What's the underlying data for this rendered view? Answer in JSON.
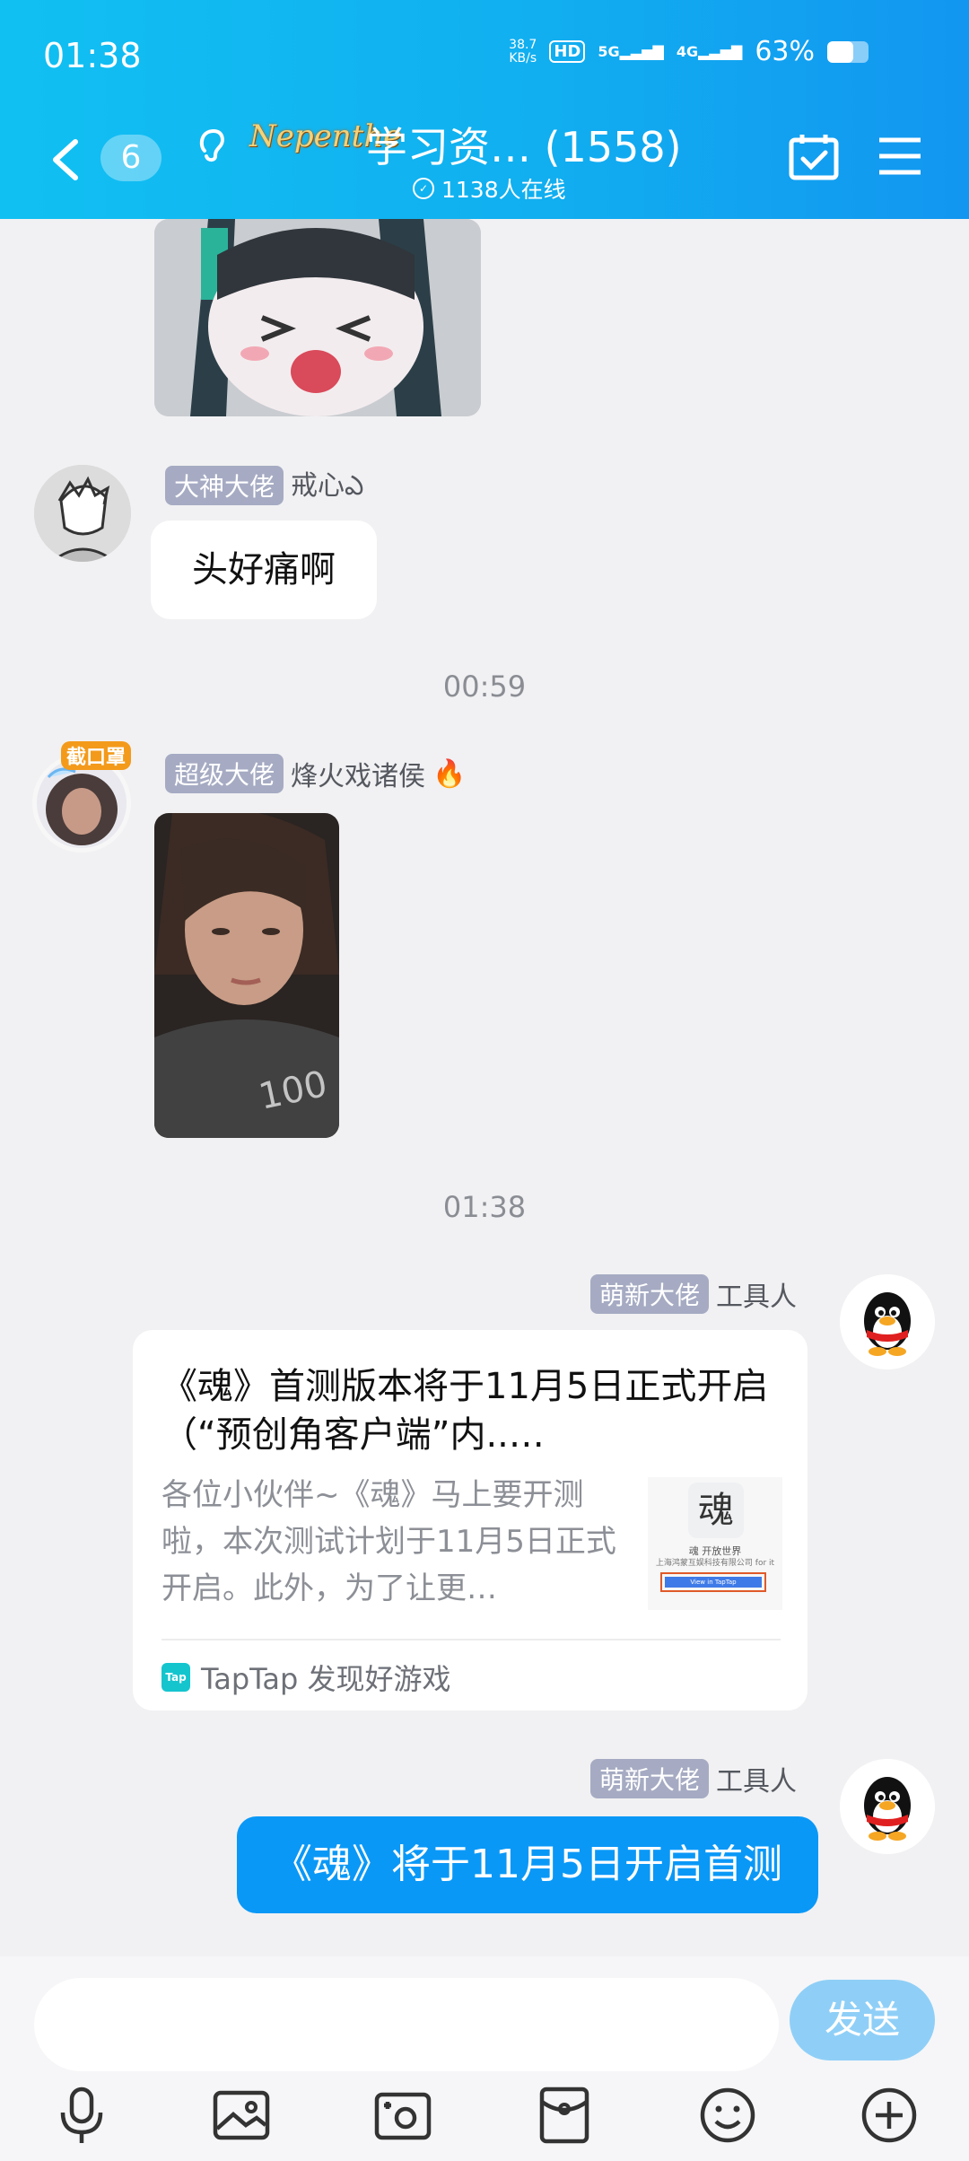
{
  "status_bar": {
    "time": "01:38",
    "net_speed_value": "38.7",
    "net_speed_unit": "KB/s",
    "hd_badge": "HD",
    "network_5g": "5G",
    "network_4g": "4G",
    "battery_percent": "63%",
    "battery_level": 0.63
  },
  "header": {
    "unread_count": "6",
    "group_logo": "Nepenthe",
    "group_title": "学习资…  (1558)",
    "online_count": "1138人在线"
  },
  "messages": {
    "msg1": {
      "role": "大神大佬",
      "sender": "戒心ఎ",
      "text": "头好痛啊"
    },
    "time1": "00:59",
    "msg2": {
      "role": "超级大佬",
      "sender": "烽火戏诸侯",
      "sender_emoji": "🔥",
      "avatar_caption": "截口罩"
    },
    "time2": "01:38",
    "msg3": {
      "role": "萌新大佬",
      "sender": "工具人",
      "card": {
        "title": "《魂》首测版本将于11月5日正式开启（“预创角客户端”内..…",
        "description": "各位小伙伴~《魂》马上要开测啦，本次测试计划于11月5日正式开启。此外，为了让更…",
        "thumb_char": "魂",
        "thumb_line1": "魂 开放世界",
        "thumb_line2": "上海鸿蒙互娱科技有限公司 for it",
        "thumb_button": "View in TapTap",
        "source_icon": "Tap",
        "source": "TapTap 发现好游戏"
      }
    },
    "msg4": {
      "role": "萌新大佬",
      "sender": "工具人",
      "text": "《魂》将于11月5日开启首测"
    }
  },
  "input": {
    "placeholder": "",
    "send_label": "发送"
  },
  "toolbar": {
    "icons": [
      "microphone-icon",
      "image-icon",
      "camera-icon",
      "red-packet-icon",
      "emoji-icon",
      "plus-icon"
    ]
  },
  "colors": {
    "header_start": "#11c0f2",
    "header_end": "#1296f0",
    "accent_blue": "#0a98f7",
    "send_disabled": "#8fcff7",
    "role_badge": "#a6abc3"
  }
}
